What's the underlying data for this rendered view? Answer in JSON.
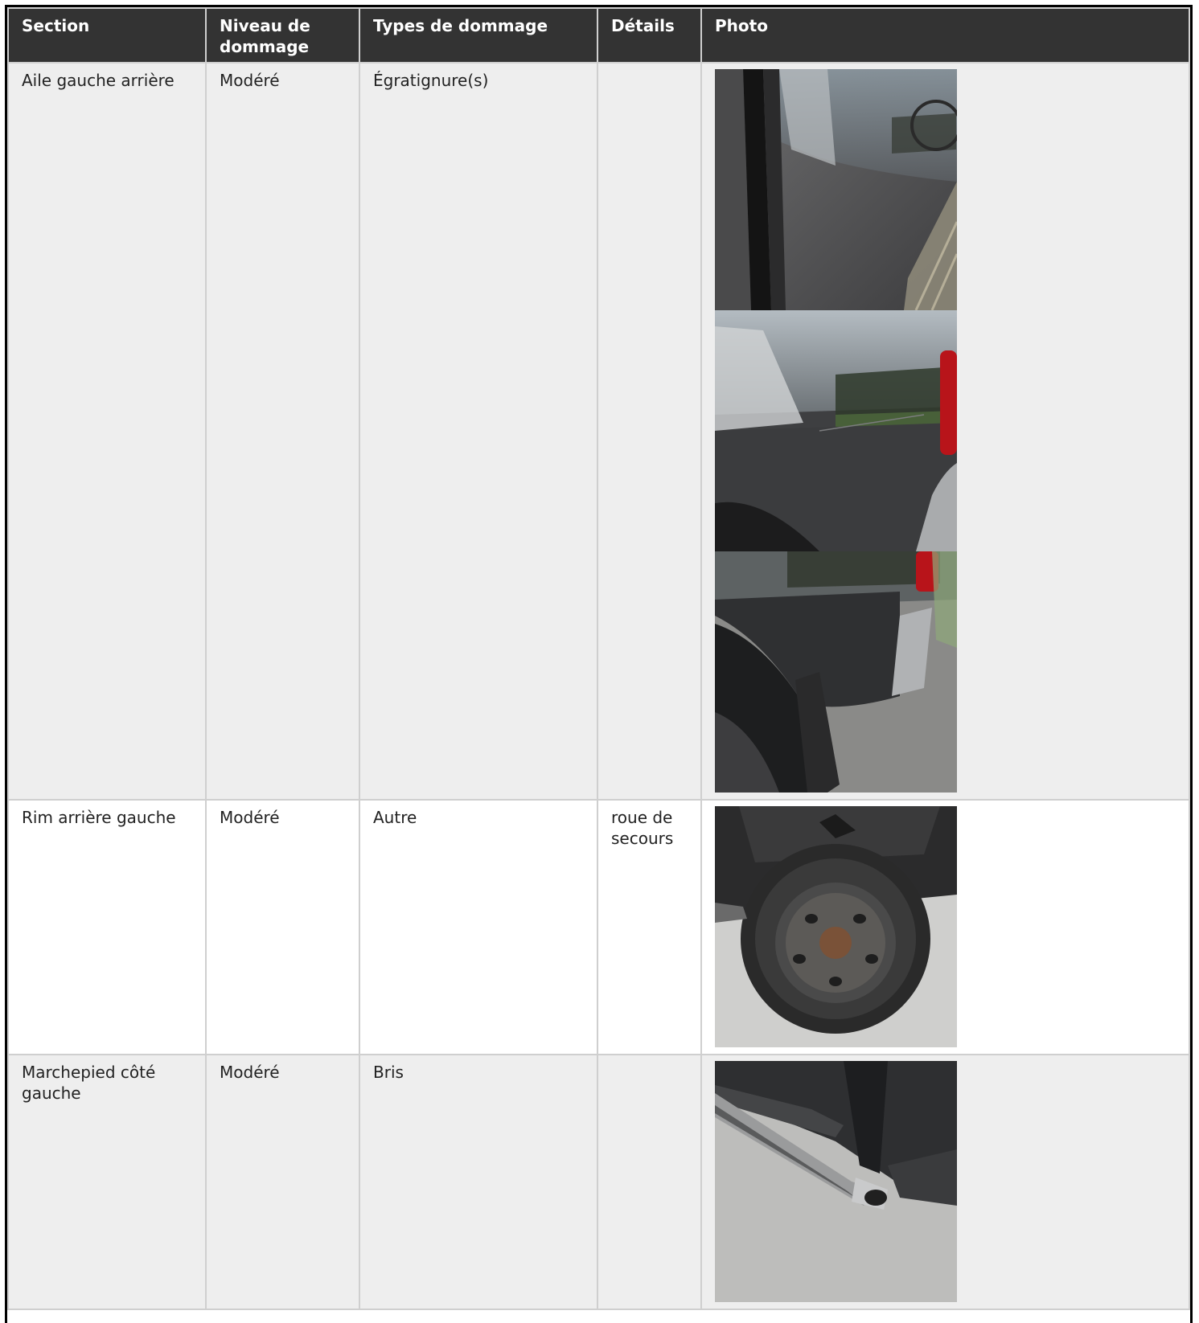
{
  "table": {
    "headers": {
      "section": "Section",
      "level": "Niveau de dommage",
      "types": "Types de dommage",
      "details": "Détails",
      "photo": "Photo"
    },
    "rows": [
      {
        "section": "Aile gauche arrière",
        "level": "Modéré",
        "types": "Égratignure(s)",
        "details": "",
        "photos": [
          "rear-left-fender-door-gap-photo",
          "rear-left-fender-scratch-photo",
          "rear-left-fender-bumper-photo"
        ]
      },
      {
        "section": "Rim arrière gauche",
        "level": "Modéré",
        "types": "Autre",
        "details": "roue de secours",
        "photos": [
          "spare-wheel-photo"
        ]
      },
      {
        "section": "Marchepied côté gauche",
        "level": "Modéré",
        "types": "Bris",
        "details": "",
        "photos": [
          "running-board-photo"
        ]
      }
    ]
  },
  "colors": {
    "header_bg": "#333333",
    "header_text": "#ffffff",
    "row_alt_bg": "#eeeeee",
    "row_bg": "#ffffff",
    "border": "#cfcfcf",
    "frame": "#000000"
  }
}
